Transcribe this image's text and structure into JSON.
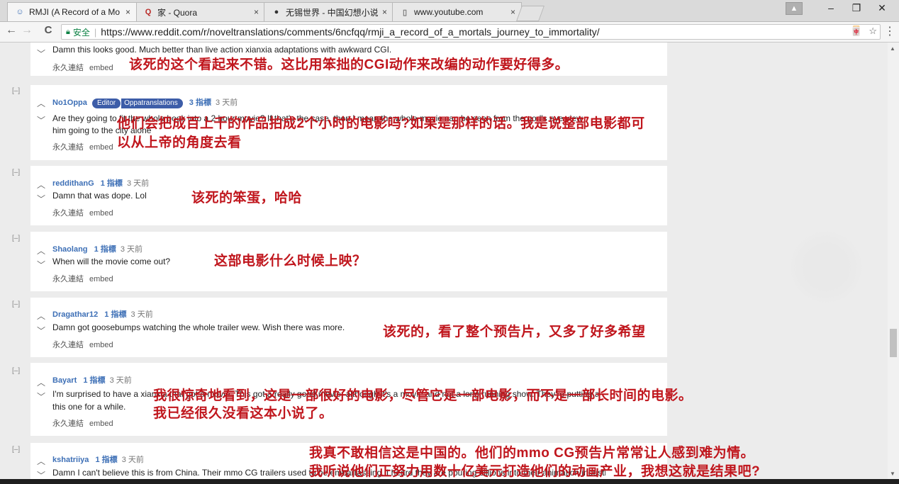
{
  "tabs": [
    {
      "title": "RMJI (A Record of a Mo",
      "icon": "reddit-icon",
      "active": true
    },
    {
      "title": "家 - Quora",
      "icon": "quora-icon",
      "active": false
    },
    {
      "title": "无锡世界 - 中国幻想小说",
      "icon": "wuxiaworld-icon",
      "active": false
    },
    {
      "title": "www.youtube.com",
      "icon": "page-icon",
      "active": false
    }
  ],
  "tab_close": "×",
  "window": {
    "user_glyph": "▲",
    "minimize": "–",
    "restore": "❐",
    "close": "✕"
  },
  "toolbar": {
    "back": "←",
    "forward": "→",
    "reload": "C",
    "secure_label": "安全",
    "url": "https://www.reddit.com/r/noveltranslations/comments/6ncfqq/rmji_a_record_of_a_mortals_journey_to_immortality/",
    "translate": "🀄",
    "star": "☆",
    "menu": "⋮"
  },
  "collapse_label": "[–]",
  "links": {
    "permalink": "永久連結",
    "embed": "embed"
  },
  "comments": [
    {
      "user": "",
      "points": "",
      "time": "",
      "flair": "",
      "flair2": "",
      "body": [
        "Damn this looks good. Much better than live action xianxia adaptations with awkward CGI."
      ],
      "annotation": [
        "该死的这个看起来不错。这比用笨拙的CGI动作来改编的动作要好得多。"
      ]
    },
    {
      "user": "No1Oppa",
      "points": "3 指標",
      "time": "3 天前",
      "flair": "Editor",
      "flair2": "Oppatranslations",
      "body": [
        "Are they going to fit the whole book into a 2 hour movie? If that's the case, then I mean the whole movie can be seen from the god's eye view",
        "him going to the city alone"
      ],
      "annotation": [
        "他们会把成百上千的作品拍成2个小时的电影吗?如果是那样的话。我是说整部电影都可",
        "以从上帝的角度去看"
      ]
    },
    {
      "user": "reddithanG",
      "points": "1 指標",
      "time": "3 天前",
      "flair": "",
      "flair2": "",
      "body": [
        "Damn that was dope. Lol"
      ],
      "annotation": [
        "该死的笨蛋，哈哈"
      ]
    },
    {
      "user": "Shaolang",
      "points": "1 指標",
      "time": "3 天前",
      "flair": "",
      "flair2": "",
      "body": [
        "When will the movie come out?"
      ],
      "annotation": [
        "这部电影什么时候上映？"
      ]
    },
    {
      "user": "Dragathar12",
      "points": "1 指標",
      "time": "3 天前",
      "flair": "",
      "flair2": "",
      "body": [
        "Damn got goosebumps watching the whole trailer wew. Wish there was more."
      ],
      "annotation": [
        "该死的，看了整个预告片，又多了好多希望"
      ]
    },
    {
      "user": "Bayart",
      "points": "1 指標",
      "time": "3 天前",
      "flair": "",
      "flair2": "",
      "body": [
        "I'm surprised to have a xianxia that got a movie. This got a really good movie, although it's a movie and not a long running show. They're putting a lot into making",
        "this one for a while."
      ],
      "annotation": [
        "我很惊奇地看到，这是一部很好的电影，尽管它是一部电影，而不是一部长时间的电影。",
        "我已经很久没看这本小说了。"
      ]
    },
    {
      "user": "kshatriiya",
      "points": "1 指標",
      "time": "3 天前",
      "flair": "",
      "flair2": "",
      "body": [
        "Damn I can't believe this is from China. Their mmo CG trailers used to be embarrassing. I heard they are pouring billions into their animation industry"
      ],
      "annotation": [
        "我真不敢相信这是中国的。他们的mmo CG预告片常常让人感到难为情。",
        "我听说他们正努力用数十亿美元打造他们的动画产业，我想这就是结果吧?"
      ]
    }
  ]
}
